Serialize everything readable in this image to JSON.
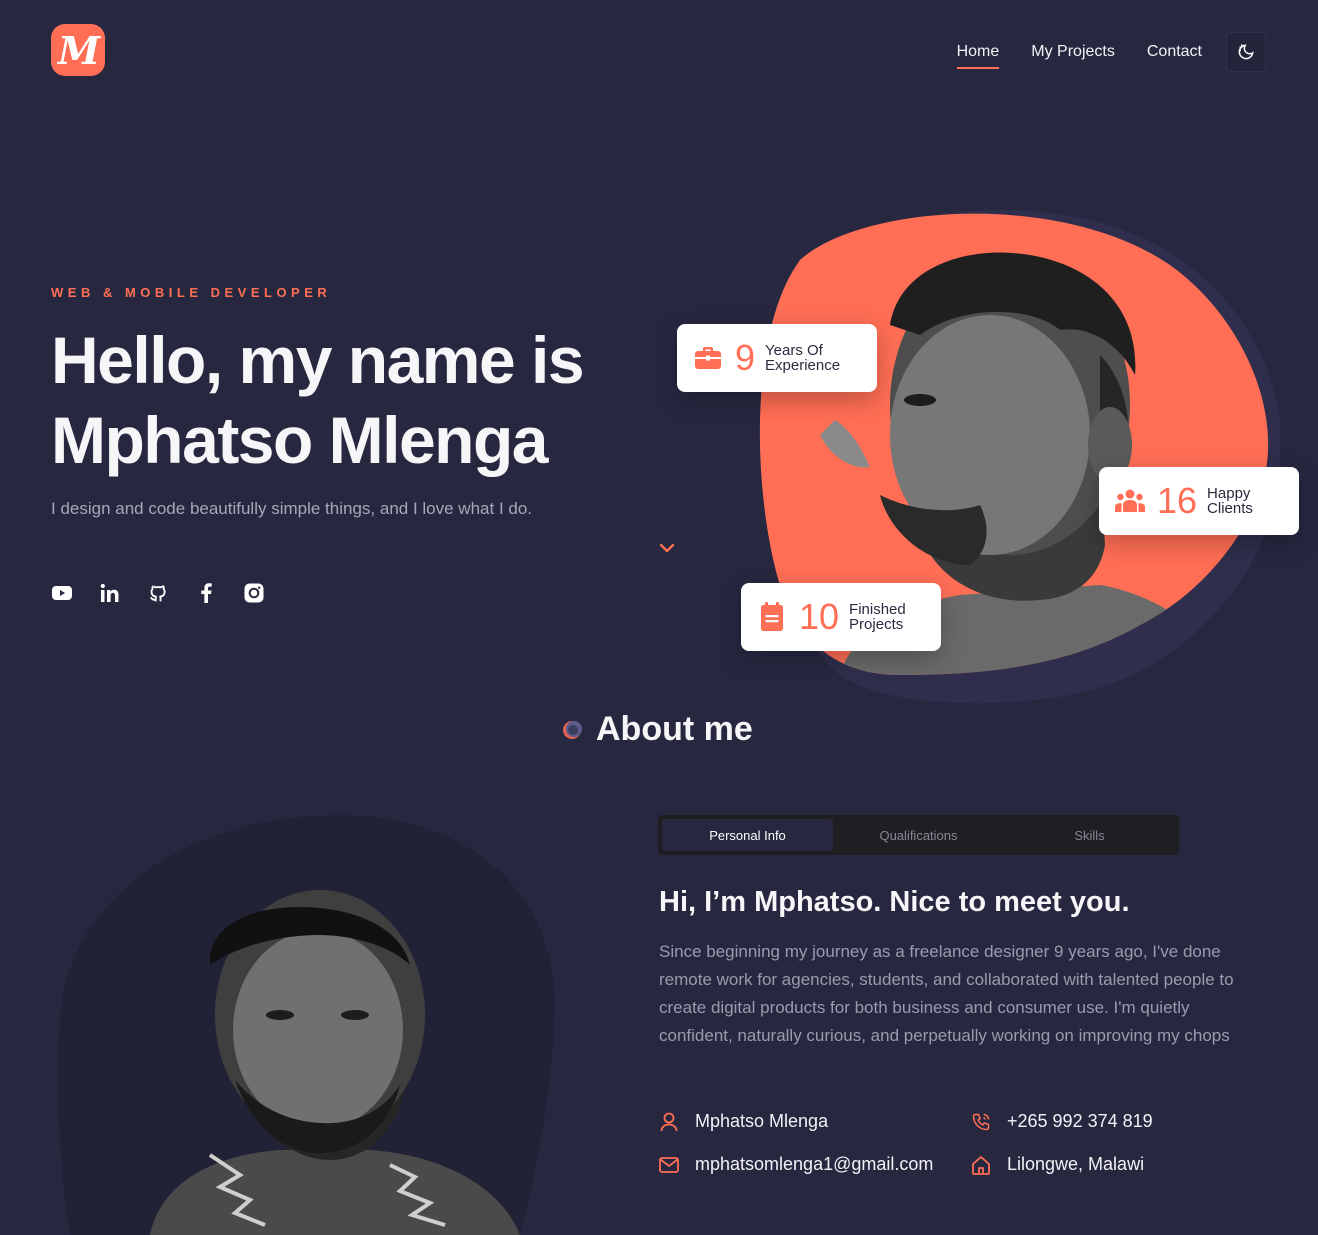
{
  "brand": {
    "logo_letter": "M",
    "accent": "#ff6e55",
    "background": "#272840"
  },
  "nav": {
    "items": [
      {
        "label": "Home",
        "active": true
      },
      {
        "label": "My Projects",
        "active": false
      },
      {
        "label": "Contact",
        "active": false
      }
    ],
    "theme_toggle_icon": "moon-icon"
  },
  "hero": {
    "eyebrow": "WEB & MOBILE DEVELOPER",
    "title": "Hello, my name is Mphatso Mlenga",
    "subtitle": "I design and code beautifully simple things, and I love what I do.",
    "socials": [
      "youtube-icon",
      "linkedin-icon",
      "github-icon",
      "facebook-icon",
      "instagram-icon"
    ],
    "scroll_icon": "chevron-down-icon",
    "stats": [
      {
        "icon": "briefcase-icon",
        "number": "9",
        "label_line1": "Years Of",
        "label_line2": "Experience"
      },
      {
        "icon": "users-icon",
        "number": "16",
        "label_line1": "Happy",
        "label_line2": "Clients"
      },
      {
        "icon": "clipboard-icon",
        "number": "10",
        "label_line1": "Finished",
        "label_line2": "Projects"
      }
    ]
  },
  "about": {
    "heading": "About me",
    "tabs": [
      {
        "label": "Personal Info",
        "active": true
      },
      {
        "label": "Qualifications",
        "active": false
      },
      {
        "label": "Skills",
        "active": false
      }
    ],
    "title": "Hi, I’m Mphatso. Nice to meet you.",
    "text": "Since beginning my journey as a freelance designer 9 years ago, I've done remote work for agencies, students, and collaborated with talented people to create digital products for both business and consumer use. I'm quietly confident, naturally curious, and perpetually working on improving my chops",
    "info": {
      "name": "Mphatso Mlenga",
      "phone": "+265 992 374 819",
      "email": "mphatsomlenga1@gmail.com",
      "location": "Lilongwe, Malawi"
    }
  }
}
